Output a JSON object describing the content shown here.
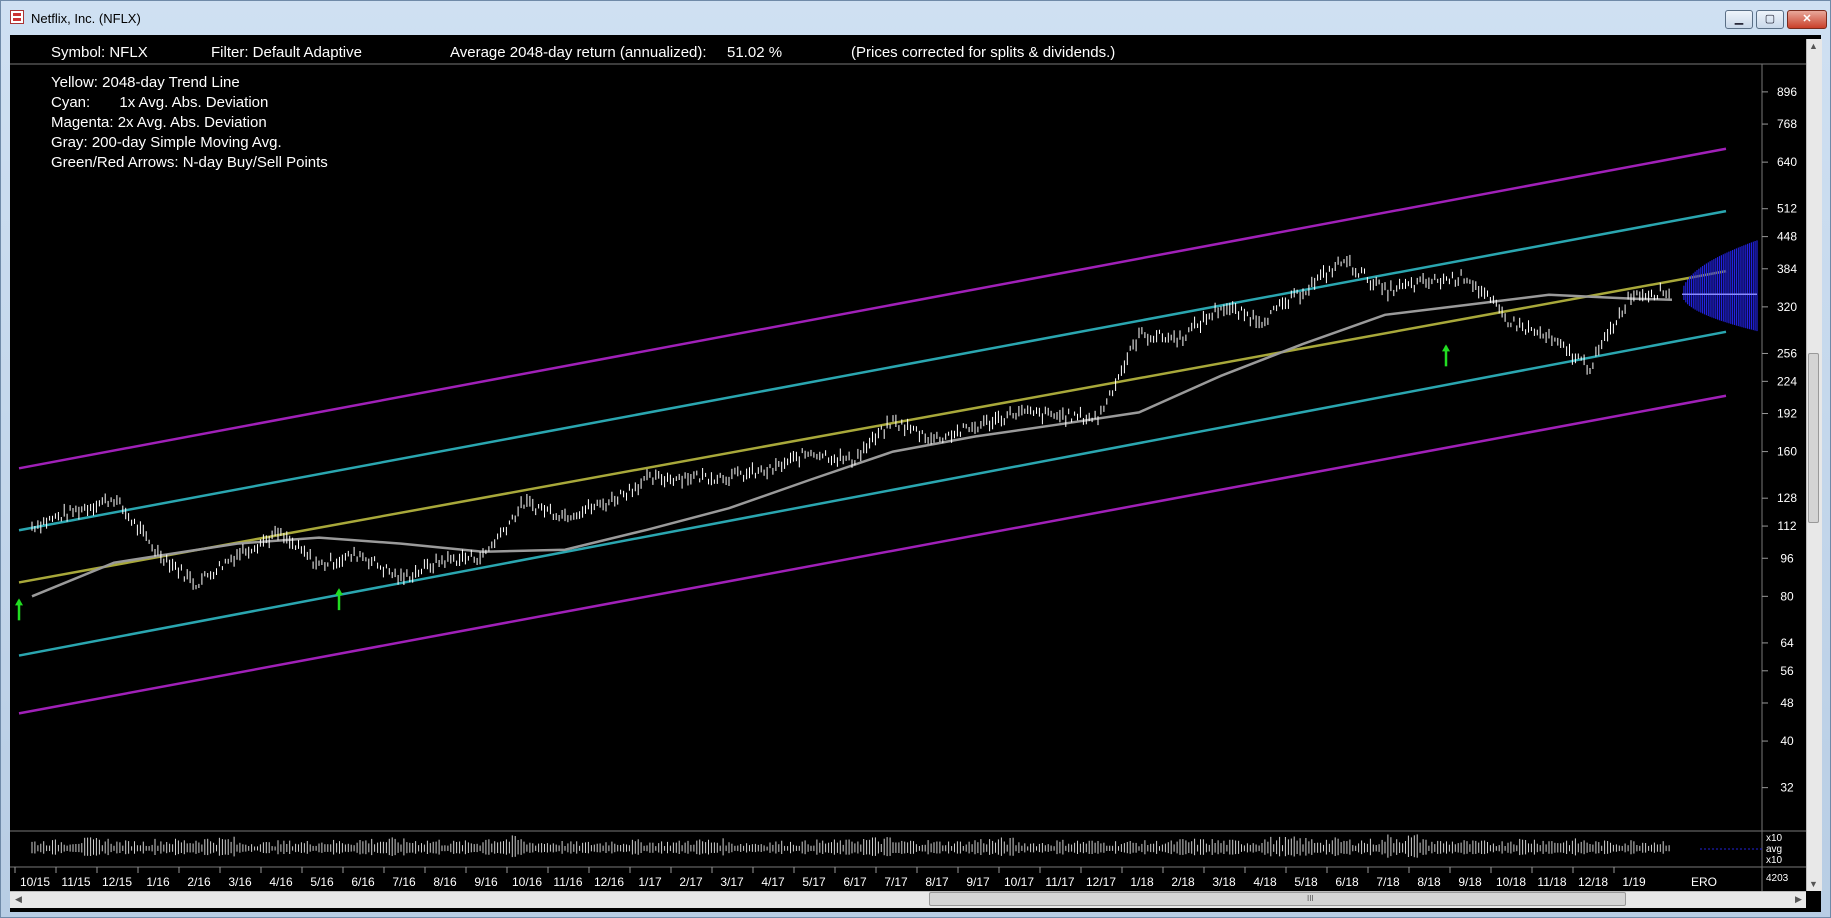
{
  "window": {
    "title": "Netflix, Inc. (NFLX)",
    "min_glyph": "▁",
    "max_glyph": "▢",
    "close_glyph": "✕"
  },
  "header": {
    "symbol": "Symbol: NFLX",
    "filter": "Filter: Default Adaptive",
    "avg_return_label": "Average 2048-day return (annualized):",
    "avg_return_value": "51.02 %",
    "note": "(Prices corrected for splits & dividends.)"
  },
  "legend": [
    "Yellow: 2048-day Trend Line",
    "Cyan:       1x Avg. Abs. Deviation",
    "Magenta: 2x Avg. Abs. Deviation",
    "Gray: 200-day Simple Moving Avg.",
    "Green/Red Arrows: N-day Buy/Sell Points"
  ],
  "volume_labels": {
    "top": "x10",
    "mid": "avg",
    "bot": "x10",
    "count": "4203"
  },
  "footer_tag": "ERO",
  "scroll": {
    "up": "▲",
    "down": "▼",
    "left": "◀",
    "right": "▶",
    "grip": "III"
  },
  "colors": {
    "background": "#000000",
    "price": "#ffffff",
    "trend": "#a8a83a",
    "cyan": "#2aa6b0",
    "magenta": "#a020b8",
    "sma": "#9a9a9a",
    "buy": "#22dd22",
    "forecast": "#2222dd",
    "axis_text": "#ffffff"
  },
  "chart_data": {
    "type": "line",
    "title": "",
    "scale": "log",
    "ylim": [
      26,
      1024
    ],
    "y_ticks": [
      896,
      768,
      640,
      512,
      448,
      384,
      320,
      256,
      224,
      192,
      160,
      128,
      112,
      96,
      80,
      64,
      56,
      48,
      40,
      32
    ],
    "x_ticks": [
      "10/15",
      "11/15",
      "12/15",
      "1/16",
      "2/16",
      "3/16",
      "4/16",
      "5/16",
      "6/16",
      "7/16",
      "8/16",
      "9/16",
      "10/16",
      "11/16",
      "12/16",
      "1/17",
      "2/17",
      "3/17",
      "4/17",
      "5/17",
      "6/17",
      "7/17",
      "8/17",
      "9/17",
      "10/17",
      "11/17",
      "12/17",
      "1/18",
      "2/18",
      "3/18",
      "4/18",
      "5/18",
      "6/18",
      "7/18",
      "8/18",
      "9/18",
      "10/18",
      "11/18",
      "12/18",
      "1/19"
    ],
    "price_x": [
      "10/15",
      "11/15",
      "12/15",
      "1/16",
      "2/16",
      "3/16",
      "4/16",
      "5/16",
      "6/16",
      "7/16",
      "8/16",
      "9/16",
      "10/16",
      "11/16",
      "12/16",
      "1/17",
      "2/17",
      "3/17",
      "4/17",
      "5/17",
      "6/17",
      "7/17",
      "8/17",
      "9/17",
      "10/17",
      "11/17",
      "12/17",
      "1/18",
      "2/18",
      "3/18",
      "4/18",
      "5/18",
      "6/18",
      "7/18",
      "8/18",
      "9/18",
      "10/18",
      "11/18",
      "12/18",
      "1/19",
      "2/19"
    ],
    "series": [
      {
        "name": "Yellow: 2048-day Trend Line",
        "role": "trend",
        "x": [
          "10/15",
          "2/19"
        ],
        "values": [
          88,
          345
        ]
      },
      {
        "name": "Cyan: 1x Avg. Abs. Deviation",
        "role": "cyan",
        "x": [
          "10/15",
          "2/19"
        ],
        "values": [
          113,
          460
        ]
      },
      {
        "name": "Cyan: 1x Avg. Abs. Deviation",
        "role": "cyan",
        "x": [
          "10/15",
          "2/19"
        ],
        "values": [
          62,
          258
        ]
      },
      {
        "name": "Magenta: 2x Avg. Abs. Deviation",
        "role": "magenta",
        "x": [
          "10/15",
          "2/19"
        ],
        "values": [
          152,
          620
        ]
      },
      {
        "name": "Magenta: 2x Avg. Abs. Deviation",
        "role": "magenta",
        "x": [
          "10/15",
          "2/19"
        ],
        "values": [
          47,
          190
        ]
      },
      {
        "name": "Gray: 200-day Simple Moving Avg.",
        "role": "sma",
        "x": [
          "10/15",
          "12/15",
          "3/16",
          "5/16",
          "7/16",
          "9/16",
          "11/16",
          "1/17",
          "3/17",
          "5/17",
          "7/17",
          "9/17",
          "11/17",
          "1/18",
          "3/18",
          "5/18",
          "7/18",
          "9/18",
          "11/18",
          "1/19",
          "2/19"
        ],
        "values": [
          80,
          94,
          103,
          106,
          103,
          99,
          100,
          110,
          122,
          140,
          160,
          172,
          182,
          193,
          230,
          268,
          308,
          323,
          339,
          333,
          331
        ]
      },
      {
        "name": "NFLX",
        "role": "price",
        "values": [
          112,
          120,
          128,
          100,
          85,
          98,
          108,
          93,
          98,
          87,
          95,
          97,
          125,
          118,
          125,
          140,
          142,
          142,
          146,
          160,
          153,
          185,
          170,
          180,
          193,
          190,
          188,
          280,
          275,
          320,
          300,
          345,
          400,
          345,
          360,
          370,
          300,
          275,
          240,
          340,
          345
        ]
      }
    ],
    "buy_points": [
      {
        "x": "10/15",
        "y": 80
      },
      {
        "x": "5/16",
        "y": 84
      },
      {
        "x": "8/18",
        "y": 270
      }
    ],
    "forecast_cone": {
      "x_start": "2/19",
      "center": 340,
      "upper": 440,
      "lower": 285
    },
    "volume": [
      10,
      12,
      9,
      11,
      13,
      8,
      9,
      10,
      12,
      11,
      9,
      14,
      9,
      8,
      10,
      9,
      11,
      8,
      9,
      10,
      13,
      10,
      9,
      12,
      8,
      10,
      9,
      9,
      11,
      10,
      13,
      12,
      11,
      16,
      10,
      9,
      12,
      11,
      9,
      10,
      9
    ]
  }
}
